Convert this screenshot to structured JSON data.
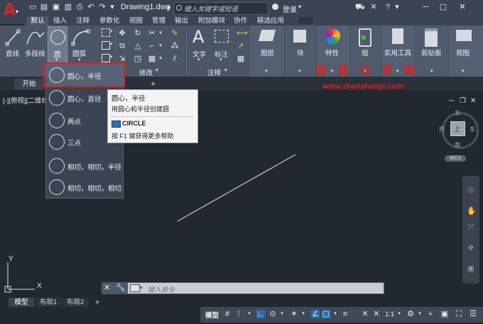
{
  "app": {
    "document_title": "Drawing1.dwg",
    "login_label": "登录"
  },
  "search": {
    "placeholder": "键入关键字或短语"
  },
  "ribbon_tabs": [
    "默认",
    "插入",
    "注释",
    "参数化",
    "视图",
    "管理",
    "输出",
    "附加模块",
    "协作",
    "精选应用"
  ],
  "ribbon": {
    "draw_tools": [
      "直线",
      "多段线",
      "圆",
      "圆弧"
    ],
    "modify_label": "修改",
    "annotation_tools": [
      "文字",
      "标注"
    ],
    "annotation_label": "注释",
    "big_tools": [
      "图层",
      "块",
      "特性",
      "组",
      "实用工具",
      "剪贴板",
      "视图"
    ]
  },
  "file_tabs": {
    "start": "开始",
    "add": "+"
  },
  "viewport_label": "[-][俯视][二维线",
  "circle_menu": [
    "圆心，半径",
    "圆心，直径",
    "两点",
    "三点",
    "相切，相切，半径",
    "相切，相切，相切"
  ],
  "tooltip": {
    "title": "圆心，半径",
    "description": "用圆心和半径创建圆",
    "command": "CIRCLE",
    "help": "按 F1 键获得更多帮助"
  },
  "watermark": {
    "cn": "我 爱 分 享 网",
    "url": "www.zhanshaoyi.com"
  },
  "viewcube": {
    "north": "北",
    "south": "南",
    "east": "东",
    "west": "西",
    "top": "上",
    "wcs": "WCS"
  },
  "ucs": {
    "x": "X",
    "y": "Y"
  },
  "command_line": {
    "placeholder": "键入命令"
  },
  "layout_tabs": [
    "模型",
    "布局1",
    "布局2",
    "+"
  ],
  "status": {
    "model_label": "模型",
    "scale": "1:1"
  },
  "colors": {
    "accent": "#d8262a",
    "selection": "#e02020",
    "ribbon": "#4a5566",
    "canvas": "#212830"
  }
}
